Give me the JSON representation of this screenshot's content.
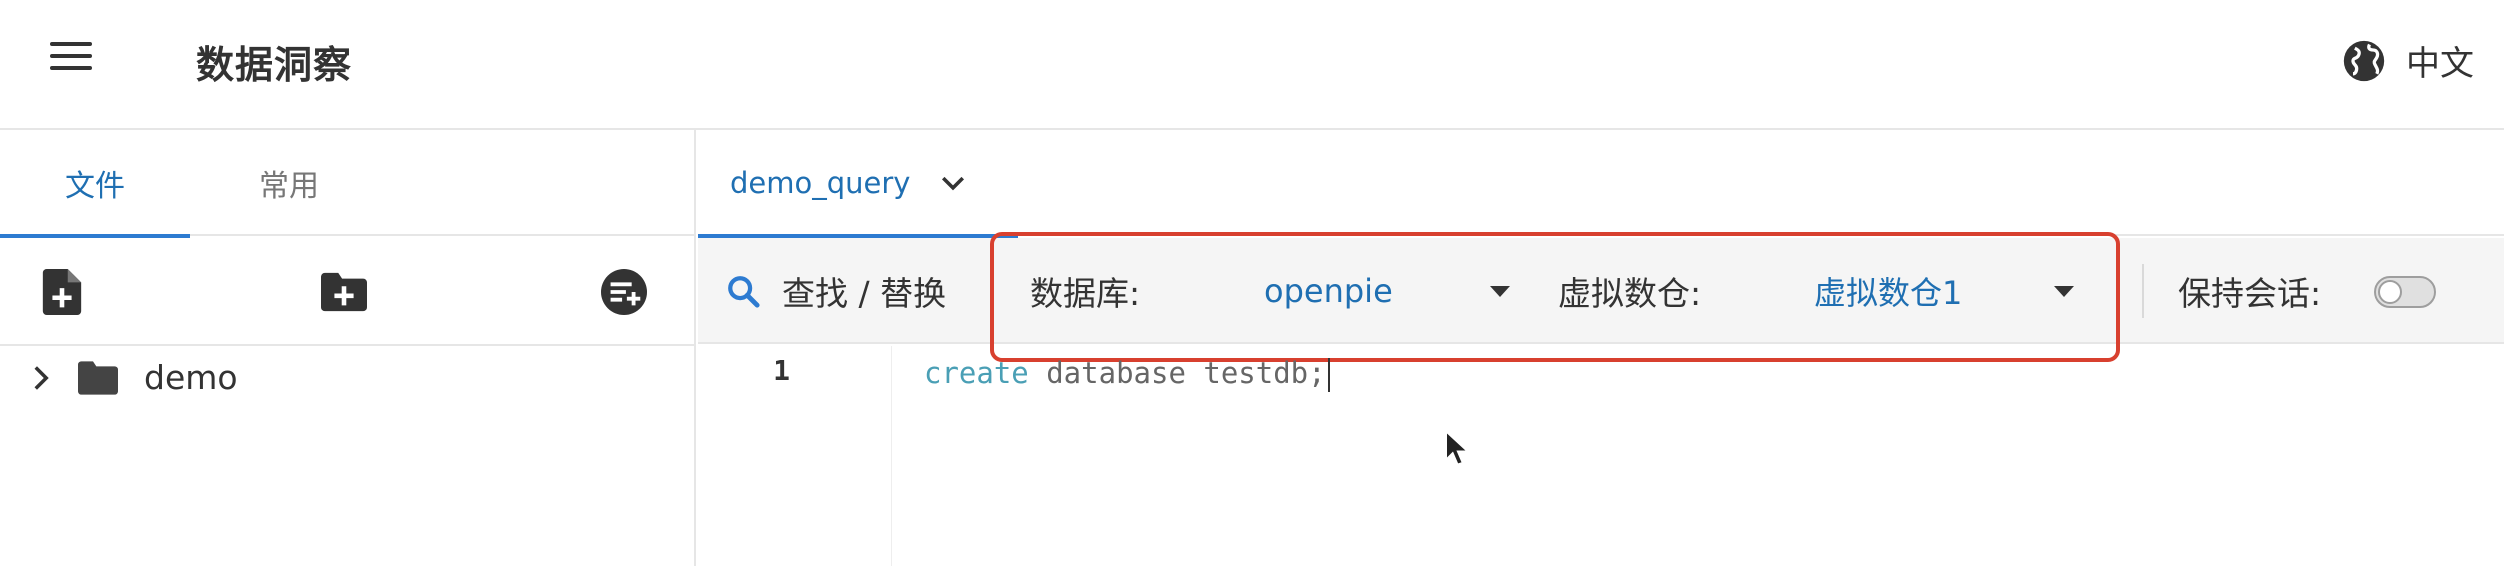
{
  "header": {
    "title": "数据洞察",
    "menu_icon": "hamburger-menu-icon",
    "language_icon": "globe-icon",
    "language_label": "中文"
  },
  "left_panel": {
    "tabs": [
      {
        "label": "文件",
        "active": true
      },
      {
        "label": "常用",
        "active": false
      }
    ],
    "actions": [
      "new-file-icon",
      "new-folder-icon",
      "add-datasource-icon"
    ],
    "tree": [
      {
        "label": "demo",
        "type": "folder",
        "expanded": false
      }
    ]
  },
  "right_panel": {
    "query_tab": {
      "label": "demo_query",
      "icon": "chevron-down-icon"
    },
    "toolbar": {
      "find_replace_label": "查找 / 替换",
      "database_label": "数据库:",
      "database_value": "openpie",
      "warehouse_label": "虚拟数仓:",
      "warehouse_value": "虚拟数仓1",
      "keep_session_label": "保持会话:",
      "keep_session_on": false
    },
    "editor": {
      "line_number": "1",
      "code_keyword": "create",
      "code_rest": " database testdb;"
    }
  },
  "colors": {
    "accent": "#1f6fb2",
    "highlight_border": "#d8402f",
    "toolbar_bg": "#f5f5f5"
  }
}
